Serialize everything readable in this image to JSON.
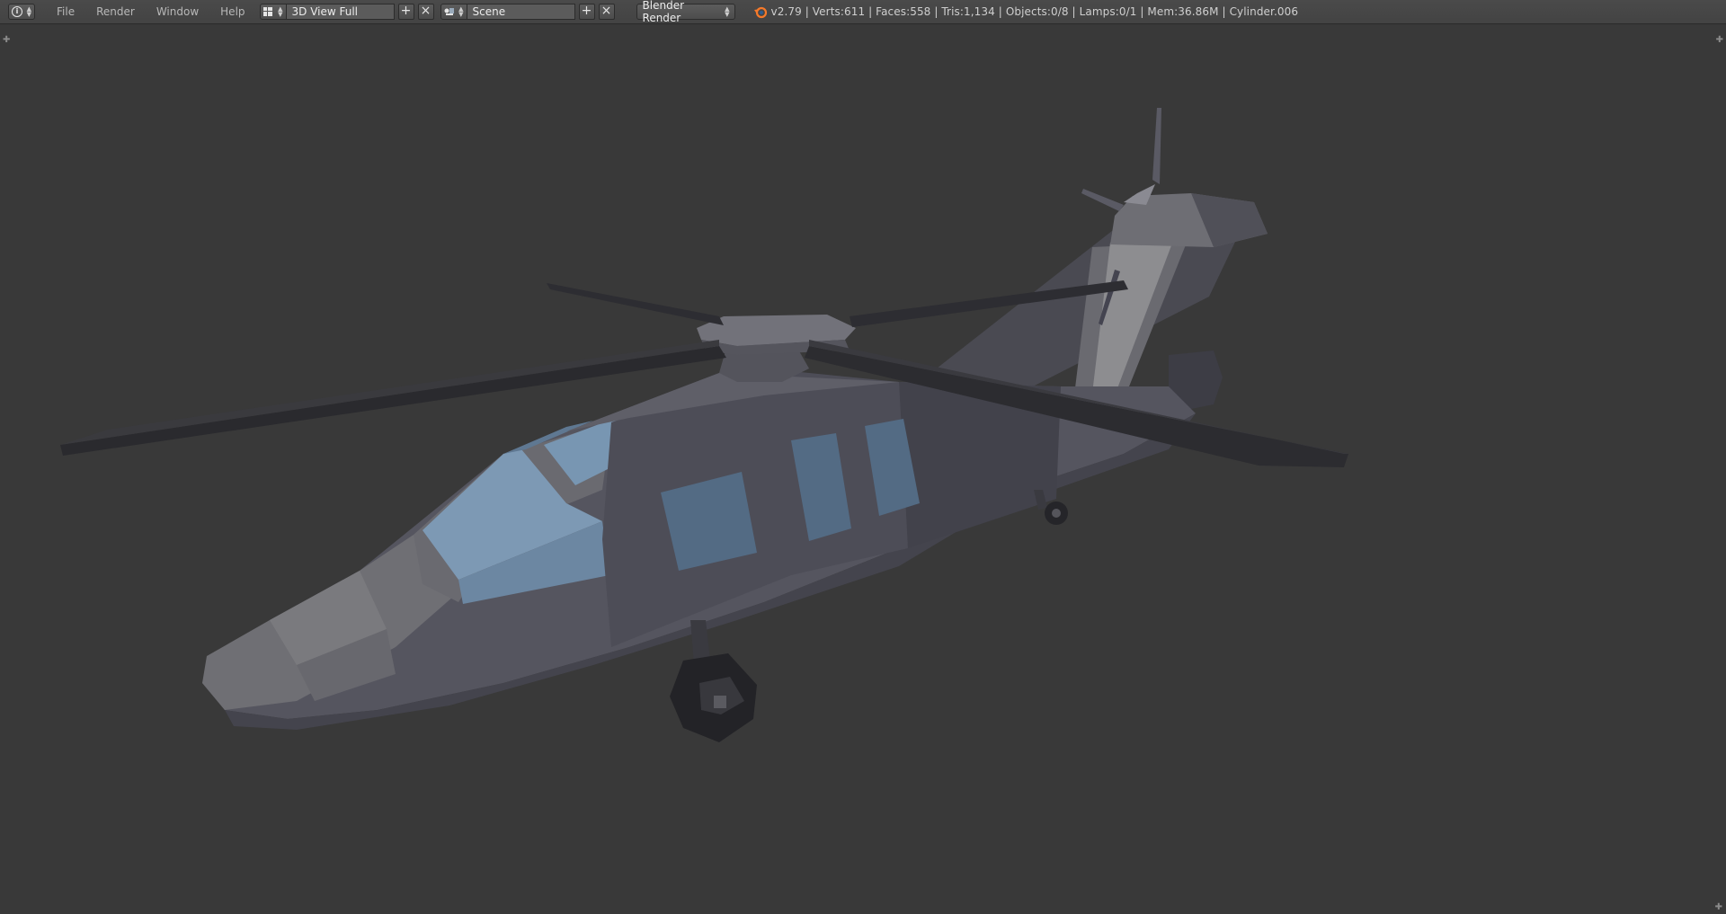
{
  "header": {
    "editor_type_icon": "info-icon",
    "menu": [
      "File",
      "Render",
      "Window",
      "Help"
    ],
    "screen_layout": {
      "icon": "layout-grid-icon",
      "value": "3D View Full"
    },
    "scene": {
      "icon": "scene-icon",
      "value": "Scene"
    },
    "render_engine": "Blender Render",
    "stats": "v2.79 | Verts:611 | Faces:558 | Tris:1,134 | Objects:0/8 | Lamps:0/1 | Mem:36.86M | Cylinder.006"
  },
  "viewport": {
    "background": "#393939",
    "subject": "low-poly helicopter model"
  },
  "colors": {
    "header_bg": "#444444",
    "viewport_bg": "#393939",
    "blender_orange": "#f5792a"
  }
}
